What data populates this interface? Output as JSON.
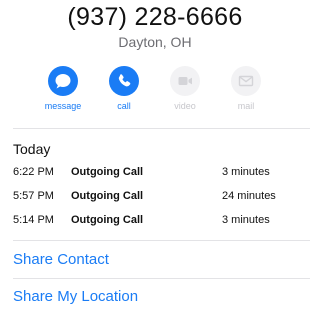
{
  "contact": {
    "phone_number": "(937) 228-6666",
    "location": "Dayton, OH"
  },
  "actions": [
    {
      "label": "message",
      "icon": "message-bubble-icon",
      "enabled": true
    },
    {
      "label": "call",
      "icon": "phone-icon",
      "enabled": true
    },
    {
      "label": "video",
      "icon": "video-camera-icon",
      "enabled": false
    },
    {
      "label": "mail",
      "icon": "envelope-icon",
      "enabled": false
    }
  ],
  "recents": {
    "section_label": "Today",
    "calls": [
      {
        "time": "6:22 PM",
        "type": "Outgoing Call",
        "duration": "3 minutes"
      },
      {
        "time": "5:57 PM",
        "type": "Outgoing Call",
        "duration": "24 minutes"
      },
      {
        "time": "5:14 PM",
        "type": "Outgoing Call",
        "duration": "3 minutes"
      }
    ]
  },
  "links": {
    "share_contact": "Share Contact",
    "share_location": "Share My Location"
  },
  "colors": {
    "accent": "#1a7cf5",
    "disabled": "#c7c7cc",
    "secondary_text": "#6d6d72"
  }
}
